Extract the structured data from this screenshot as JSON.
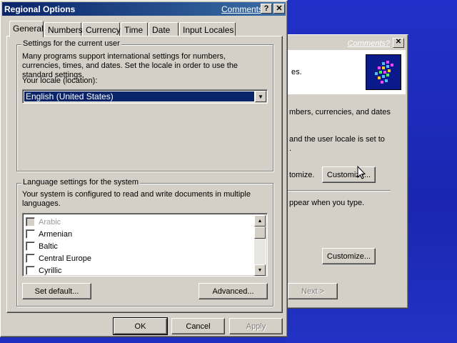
{
  "window": {
    "title": "Regional Options",
    "comments_link": "Comments?",
    "help_btn": "?",
    "close_btn": "×"
  },
  "tabs": [
    {
      "label": "General",
      "active": true
    },
    {
      "label": "Numbers"
    },
    {
      "label": "Currency"
    },
    {
      "label": "Time"
    },
    {
      "label": "Date"
    },
    {
      "label": "Input Locales"
    }
  ],
  "user_settings": {
    "group_label": "Settings for the current user",
    "description": "Many programs support international settings for numbers, currencies, times, and dates. Set the locale in order to use the standard settings.",
    "locale_label": "Your locale (location):",
    "locale_value": "English (United States)"
  },
  "system_settings": {
    "group_label": "Language settings for the system",
    "description": "Your system is configured to read and write documents in multiple languages.",
    "languages": [
      {
        "label": "Arabic",
        "checked": false,
        "enabled": false
      },
      {
        "label": "Armenian",
        "checked": false,
        "enabled": true
      },
      {
        "label": "Baltic",
        "checked": false,
        "enabled": true
      },
      {
        "label": "Central Europe",
        "checked": false,
        "enabled": true
      },
      {
        "label": "Cyrillic",
        "checked": false,
        "enabled": true
      }
    ],
    "set_default_btn": "Set default...",
    "advanced_btn": "Advanced..."
  },
  "footer": {
    "ok": "OK",
    "cancel": "Cancel",
    "apply": "Apply"
  },
  "background_window": {
    "comments_link": "Comments?",
    "header_text": "es.",
    "line1": "mbers, currencies, and dates",
    "line2": "and the user locale is set to",
    "line3": ".",
    "line4": "tomize.",
    "customize1": "Customize...",
    "line5": "ppear when you type.",
    "customize2": "Customize...",
    "next_btn": "Next >"
  },
  "colors": {
    "desktop": "#1f2fbe",
    "title_bar_start": "#0a246a",
    "title_bar_end": "#3a6ea5",
    "selection": "#0a246a",
    "window_face": "#d4d0c8"
  }
}
